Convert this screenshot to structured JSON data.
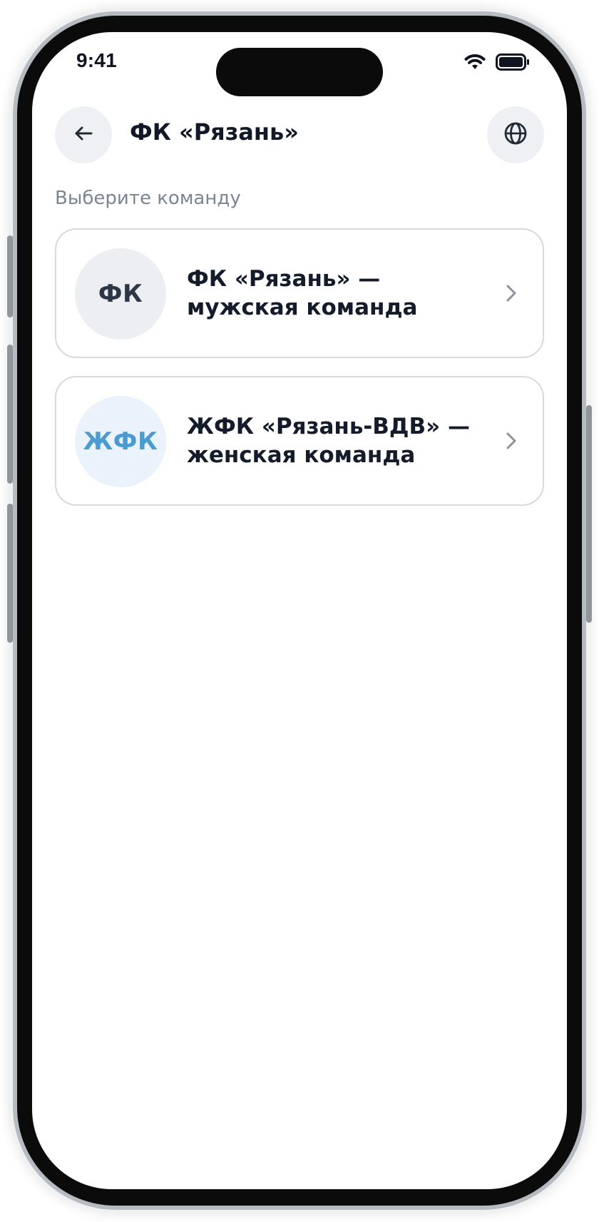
{
  "status_bar": {
    "time": "9:41",
    "icons": [
      "wifi-icon",
      "battery-icon"
    ]
  },
  "header": {
    "back_icon": "arrow-left-icon",
    "title": "ФК «Рязань»",
    "language_icon": "globe-icon"
  },
  "section": {
    "label": "Выберите команду"
  },
  "teams": [
    {
      "abbr": "ФК",
      "name_line1": "ФК «Рязань» —",
      "name_line2": "мужская команда",
      "avatar_color": "#2C3748",
      "avatar_bg": "#ECEEF2"
    },
    {
      "abbr": "ЖФК",
      "name_line1": "ЖФК «Рязань-ВДВ» —",
      "name_line2": "женская команда",
      "avatar_color": "#4B9BD0",
      "avatar_bg": "#EAF3FB"
    }
  ],
  "colors": {
    "text_primary": "#111827",
    "text_secondary": "#7B8593",
    "card_border": "#D6D9DE",
    "button_bg": "#EEF0F3"
  }
}
